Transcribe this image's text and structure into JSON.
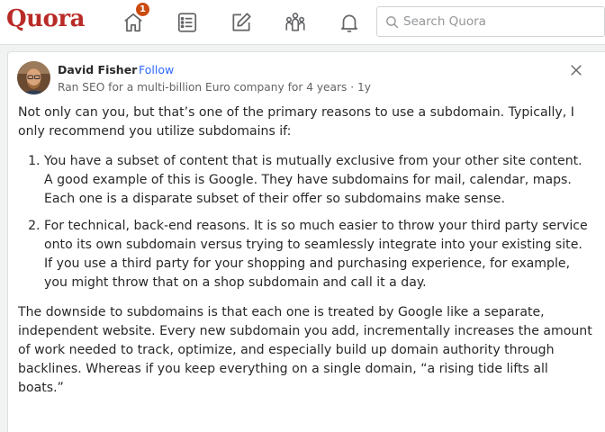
{
  "header": {
    "logo": "Quora",
    "notification_count": "1",
    "search_placeholder": "Search Quora"
  },
  "post": {
    "author": "David Fisher",
    "separator": "·",
    "follow_label": "Follow",
    "credential": "Ran SEO for a multi-billion Euro company for 4 years · 1y",
    "intro": "Not only can you, but that’s one of the primary reasons to use a subdomain. Typically, I only recommend you utilize subdomains if:",
    "list": [
      "You have a subset of content that is mutually exclusive from your other site content. A good example of this is Google. They have subdomains for mail, calendar, maps. Each one is a disparate subset of their offer so subdomains make sense.",
      "For technical, back-end reasons. It is so much easier to throw your third party service onto its own subdomain versus trying to seamlessly integrate into your existing site. If you use a third party for your shopping and purchasing experience, for example, you might throw that on a shop subdomain and call it a day."
    ],
    "conclusion": "The downside to subdomains is that each one is treated by Google like a separate, independent website. Every new subdomain you add, incrementally increases the amount of work needed to track, optimize, and especially build up domain authority through backlines. Whereas if you keep everything on a single domain, “a rising tide lifts all boats.”"
  },
  "colors": {
    "brand": "#b92b27",
    "link": "#2e69ff",
    "badge": "#cb4b10"
  },
  "icons": [
    "home-icon",
    "following-icon",
    "answer-icon",
    "spaces-icon",
    "notifications-icon",
    "search-icon",
    "close-icon"
  ]
}
